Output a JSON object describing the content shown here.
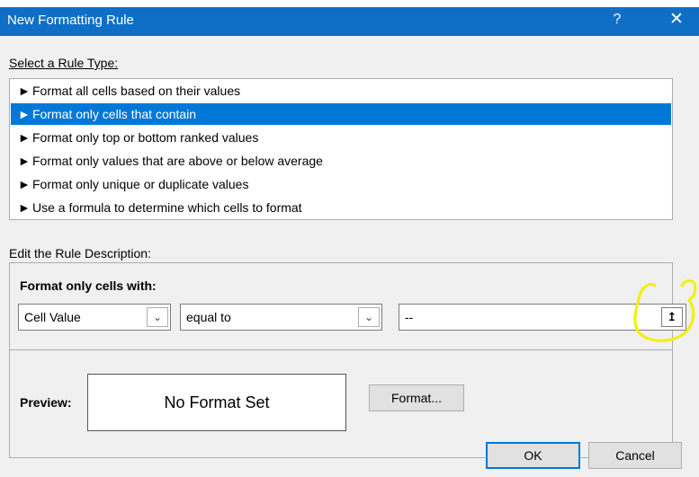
{
  "window": {
    "title": "New Formatting Rule",
    "help_glyph": "?",
    "close_glyph": "✕"
  },
  "rule_type": {
    "label": "Select a Rule Type:",
    "items": [
      {
        "label": "Format all cells based on their values",
        "selected": false
      },
      {
        "label": "Format only cells that contain",
        "selected": true
      },
      {
        "label": "Format only top or bottom ranked values",
        "selected": false
      },
      {
        "label": "Format only values that are above or below average",
        "selected": false
      },
      {
        "label": "Format only unique or duplicate values",
        "selected": false
      },
      {
        "label": "Use a formula to determine which cells to format",
        "selected": false
      }
    ]
  },
  "description": {
    "label": "Edit the Rule Description:",
    "section_label": "Format only cells with:",
    "condition_type": "Cell Value",
    "operator": "equal to",
    "value": "--",
    "preview_label": "Preview:",
    "preview_text": "No Format Set",
    "format_button": "Format..."
  },
  "buttons": {
    "ok": "OK",
    "cancel": "Cancel"
  },
  "colors": {
    "titlebar": "#0f6fc6",
    "selection": "#0078d7",
    "highlight_annotation": "#f2f000"
  }
}
